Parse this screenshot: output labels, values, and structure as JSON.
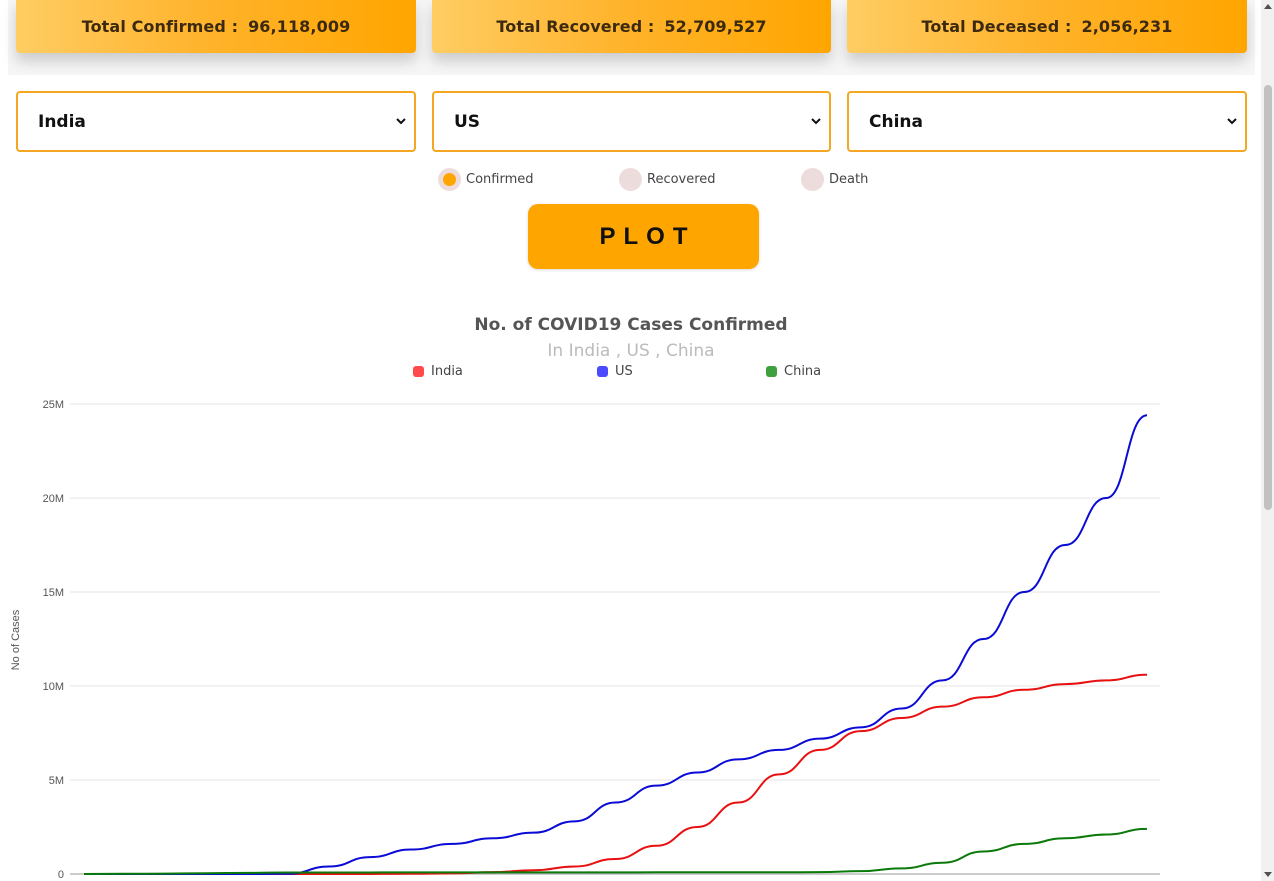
{
  "stats": {
    "confirmed_label": "Total Confirmed :",
    "confirmed_value": "96,118,009",
    "recovered_label": "Total Recovered :",
    "recovered_value": "52,709,527",
    "deceased_label": "Total Deceased :",
    "deceased_value": "2,056,231"
  },
  "selects": {
    "country1": "India",
    "country2": "US",
    "country3": "China"
  },
  "radios": {
    "confirmed": "Confirmed",
    "recovered": "Recovered",
    "death": "Death",
    "selected": "confirmed"
  },
  "plot_button": "PLOT",
  "colors": {
    "accent": "#ffa500",
    "india": "#e81010",
    "us": "#0b0bd6",
    "china": "#0a7a0a"
  },
  "chart_data": {
    "type": "line",
    "title": "No. of COVID19 Cases Confirmed",
    "subtitle": "In India , US , China",
    "ylabel": "No of Cases",
    "xlabel": "",
    "ylim": [
      0,
      25000000
    ],
    "yticks": [
      "0",
      "5M",
      "10M",
      "15M",
      "20M",
      "25M"
    ],
    "grid": true,
    "legend_position": "top-center",
    "legend": [
      "India",
      "US",
      "China"
    ],
    "series": [
      {
        "name": "India",
        "values": [
          0,
          0,
          0,
          0,
          0,
          0,
          0,
          2000,
          10000,
          35000,
          100000,
          200000,
          400000,
          800000,
          1500000,
          2500000,
          3800000,
          5300000,
          6600000,
          7600000,
          8300000,
          8900000,
          9400000,
          9800000,
          10100000,
          10300000,
          10600000
        ]
      },
      {
        "name": "US",
        "values": [
          0,
          0,
          0,
          0,
          0,
          15000,
          400000,
          900000,
          1300000,
          1600000,
          1900000,
          2200000,
          2800000,
          3800000,
          4700000,
          5400000,
          6100000,
          6600000,
          7200000,
          7800000,
          8800000,
          10300000,
          12500000,
          15000000,
          17500000,
          20000000,
          24400000
        ]
      },
      {
        "name": "China",
        "values": [
          0,
          10000,
          20000,
          40000,
          60000,
          80000,
          82000,
          83000,
          84000,
          85000,
          86000,
          87000,
          88000,
          89000,
          90000,
          90000,
          90000,
          91000,
          100000,
          150000,
          300000,
          600000,
          1200000,
          1600000,
          1900000,
          2100000,
          2400000
        ]
      }
    ]
  }
}
